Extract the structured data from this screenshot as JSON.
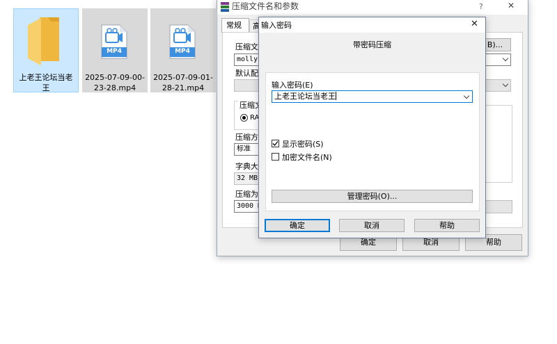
{
  "desktop": {
    "items": [
      {
        "name": "上老王论坛当老王",
        "type": "folder"
      },
      {
        "name": "2025-07-09-00-23-28.mp4",
        "type": "video",
        "badge": "MP4"
      },
      {
        "name": "2025-07-09-01-28-21.mp4",
        "type": "video",
        "badge": "MP4"
      }
    ]
  },
  "archive_dialog": {
    "title": "压缩文件名和参数",
    "help_glyph": "?",
    "close_glyph": "✕",
    "tabs": [
      "常规",
      "高"
    ],
    "archive_name_label": "压缩文",
    "archive_name_value": "mollyf",
    "browse_button": "B)...",
    "profile_label": "默认配",
    "format_group_label": "压缩文",
    "format_rar_label": "RA",
    "method_label": "压缩方",
    "method_value": "标准",
    "dict_label": "字典大",
    "dict_value": "32 MB",
    "split_label": "压缩为",
    "split_value": "3000 M",
    "ok": "确定",
    "cancel": "取消",
    "help": "帮助"
  },
  "password_dialog": {
    "title": "输入密码",
    "close_glyph": "✕",
    "heading": "带密码压缩",
    "password_label": "输入密码(E)",
    "password_value": "上老王论坛当老王",
    "show_password_label": "显示密码(S)",
    "show_password_checked": true,
    "encrypt_names_label": "加密文件名(N)",
    "encrypt_names_checked": false,
    "manage_button": "管理密码(O)...",
    "ok": "确定",
    "cancel": "取消",
    "help": "帮助"
  },
  "colors": {
    "selection": "#cce8ff",
    "folder": "#f5c14d",
    "video_badge": "#3d8fe0",
    "accent_border": "#0078d7"
  }
}
